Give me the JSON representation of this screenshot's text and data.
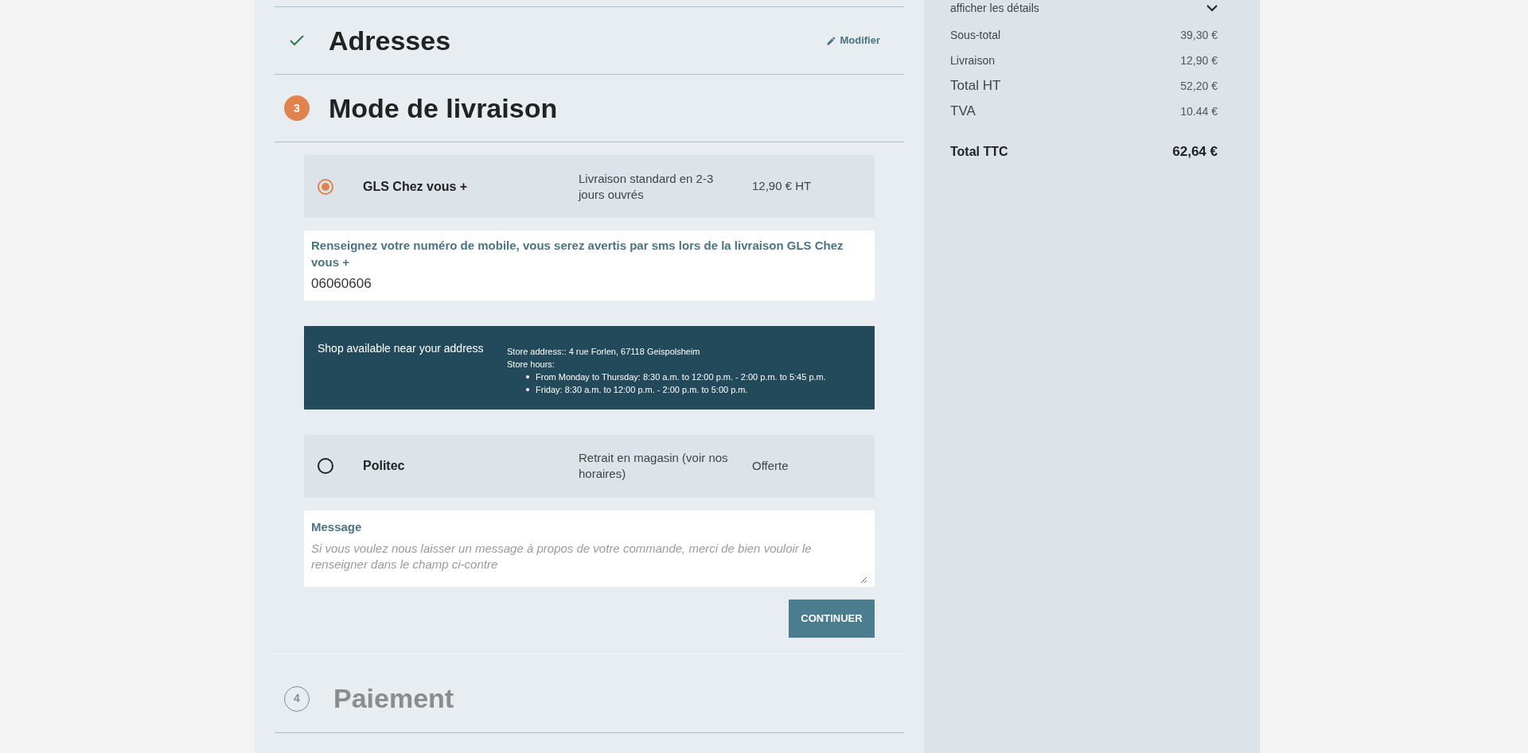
{
  "steps": [
    {
      "kind": "done",
      "title": "Adresses",
      "action": "Modifier"
    },
    {
      "kind": "current",
      "number": "3",
      "title": "Mode de livraison"
    },
    {
      "kind": "upcoming",
      "number": "4",
      "title": "Paiement"
    }
  ],
  "delivery": {
    "options": [
      {
        "name": "GLS Chez vous +",
        "description": "Livraison standard en 2-3 jours ouvrés",
        "price": "12,90 € HT",
        "selected": true,
        "phone_field": {
          "label": "Renseignez votre numéro de mobile, vous serez avertis par sms lors de la livraison GLS Chez vous +",
          "value": "06060606"
        },
        "shop_notice": {
          "title": "Shop available near your address",
          "address": "Store address:: 4 rue Forlen, 67118 Geispolsheim",
          "hours_label": "Store hours:",
          "hours": [
            "From Monday to Thursday: 8:30 a.m. to 12:00 p.m. - 2:00 p.m. to 5:45 p.m.",
            "Friday: 8:30 a.m. to 12:00 p.m. - 2:00 p.m. to 5:00 p.m."
          ]
        }
      },
      {
        "name": "Politec",
        "description": "Retrait en magasin (voir nos horaires)",
        "price": "Offerte",
        "selected": false
      }
    ],
    "message": {
      "label": "Message",
      "placeholder": "Si vous voulez nous laisser un message à propos de votre commande, merci de bien vouloir le renseigner dans le champ ci-contre"
    },
    "continue_button": "CONTINUER"
  },
  "summary": {
    "details_toggle": "afficher les détails",
    "lines": [
      {
        "label": "Sous-total",
        "value": "39,30 €"
      },
      {
        "label": "Livraison",
        "value": "12,90 €"
      },
      {
        "label": "Total HT",
        "value": "52,20 €"
      },
      {
        "label": "TVA",
        "value": "10.44 €"
      }
    ],
    "total": {
      "label": "Total TTC",
      "value": "62,64 €"
    }
  }
}
